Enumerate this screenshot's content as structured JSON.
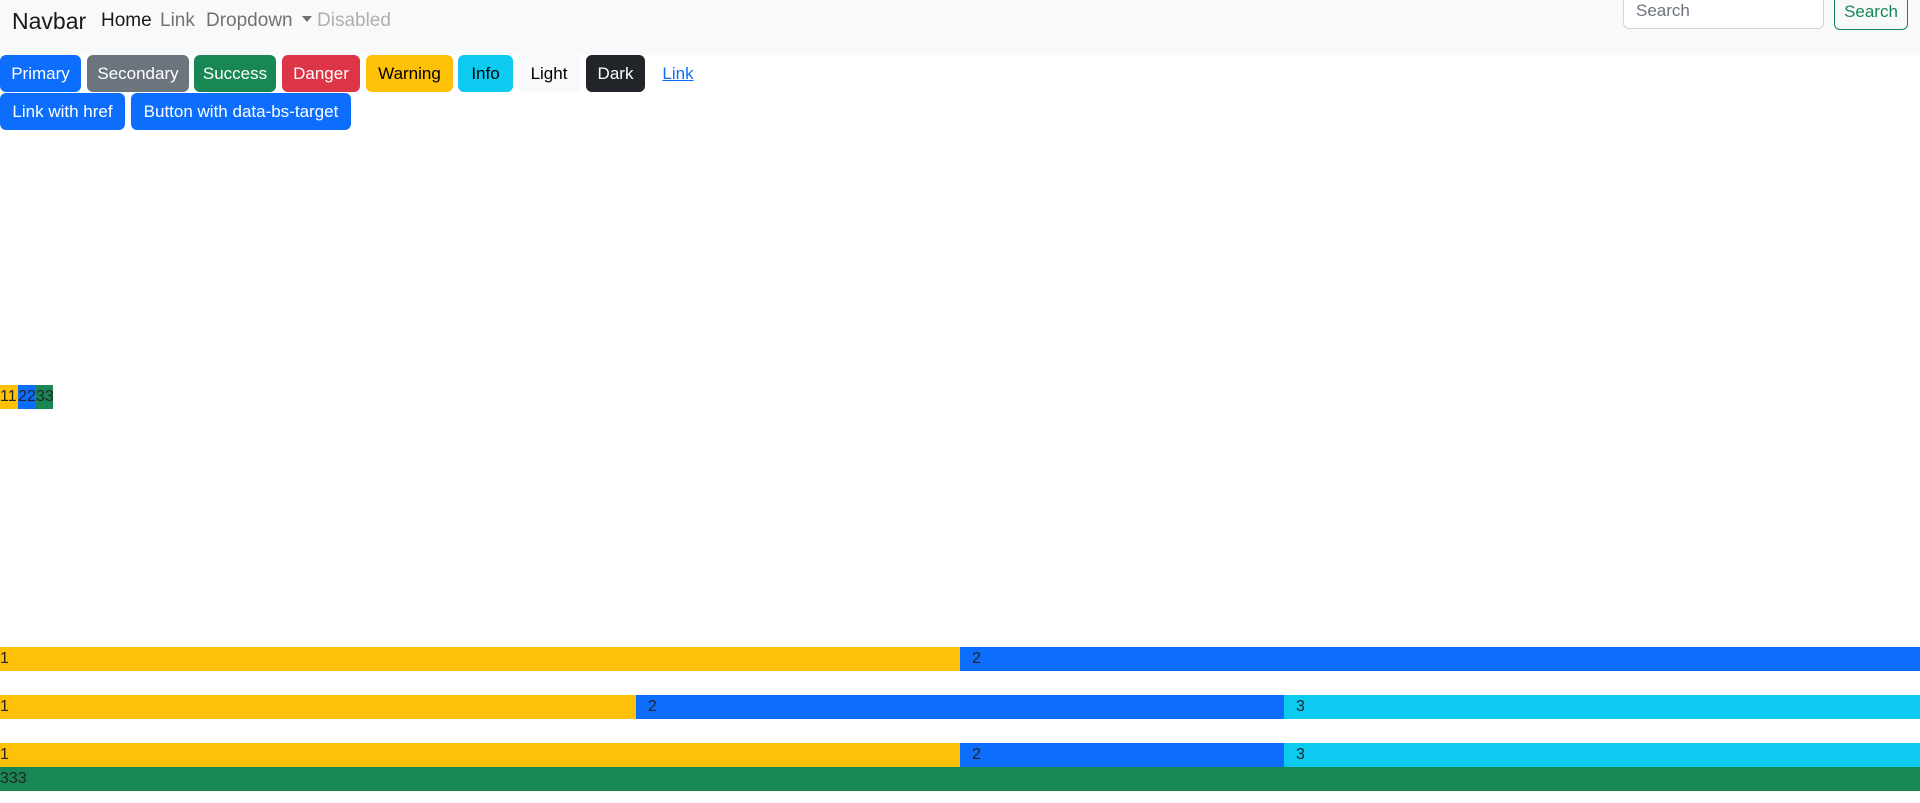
{
  "navbar": {
    "brand": "Navbar",
    "links": [
      {
        "label": "Home"
      },
      {
        "label": "Link"
      },
      {
        "label": "Dropdown"
      },
      {
        "label": "Disabled"
      }
    ],
    "search": {
      "placeholder": "Search",
      "value": "",
      "button_label": "Search"
    }
  },
  "buttons": {
    "primary": "Primary",
    "secondary": "Secondary",
    "success": "Success",
    "danger": "Danger",
    "warning": "Warning",
    "info": "Info",
    "light": "Light",
    "dark": "Dark",
    "link": "Link",
    "link_with_href": "Link with href",
    "button_with_target": "Button with data-bs-target"
  },
  "small_row": {
    "cells": [
      "11",
      "22",
      "33"
    ]
  },
  "rows": [
    {
      "cells": [
        "1",
        "2"
      ]
    },
    {
      "cells": [
        "1",
        "2",
        "3"
      ]
    },
    {
      "cells": [
        "1",
        "2",
        "3"
      ]
    }
  ],
  "bottom_row": {
    "cells": [
      "333"
    ]
  },
  "colors": {
    "primary": "#0d6efd",
    "secondary": "#6c757d",
    "success": "#198754",
    "danger": "#dc3545",
    "warning": "#ffc107",
    "info": "#0dcaf0",
    "light": "#f8f9fa",
    "dark": "#212529",
    "navbar_bg": "#f8f9fa"
  }
}
